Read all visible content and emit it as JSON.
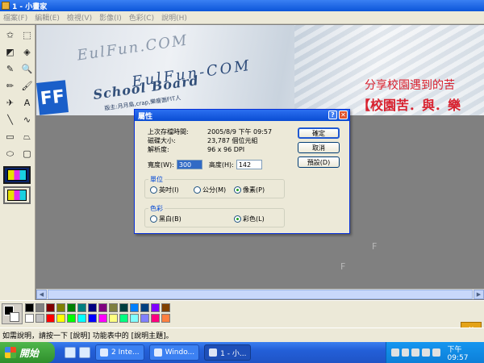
{
  "window": {
    "title": "1 - 小畫家"
  },
  "menu": [
    "檔案(F)",
    "編輯(E)",
    "檢視(V)",
    "影像(I)",
    "色彩(C)",
    "說明(H)"
  ],
  "tools": [
    {
      "name": "free-select-icon",
      "glyph": "✩"
    },
    {
      "name": "rect-select-icon",
      "glyph": "⬚"
    },
    {
      "name": "eraser-icon",
      "glyph": "◩"
    },
    {
      "name": "fill-bucket-icon",
      "glyph": "◈"
    },
    {
      "name": "color-picker-icon",
      "glyph": "✎"
    },
    {
      "name": "magnifier-icon",
      "glyph": "🔍"
    },
    {
      "name": "pencil-icon",
      "glyph": "✏"
    },
    {
      "name": "brush-icon",
      "glyph": "🖌"
    },
    {
      "name": "airbrush-icon",
      "glyph": "✈"
    },
    {
      "name": "text-icon",
      "glyph": "A"
    },
    {
      "name": "line-icon",
      "glyph": "╲"
    },
    {
      "name": "curve-icon",
      "glyph": "∿"
    },
    {
      "name": "rectangle-icon",
      "glyph": "▭"
    },
    {
      "name": "polygon-icon",
      "glyph": "⏢"
    },
    {
      "name": "ellipse-icon",
      "glyph": "⬭"
    },
    {
      "name": "rounded-rect-icon",
      "glyph": "▢"
    }
  ],
  "canvas": {
    "board_line1": "EulFun.COM",
    "board_line2": "School Board",
    "board_line3": "EulFun-COM",
    "board_subtitle": "版主:月月島,crap,樂瘦面FIT人",
    "logo_text": "FF",
    "slogan1": "分享校園遇到的苦",
    "slogan2": "【校園苦．與．樂",
    "ghost_letter": "F"
  },
  "dialog": {
    "title": "屬性",
    "rows": [
      {
        "label": "上次存檔時間:",
        "value": "2005/8/9 下午 09:57"
      },
      {
        "label": "磁碟大小:",
        "value": "23,787 個位元組"
      },
      {
        "label": "解析度:",
        "value": "96 x 96 DPI"
      }
    ],
    "buttons": {
      "ok": "確定",
      "cancel": "取消",
      "default": "預設(D)"
    },
    "width_label": "寬度(W):",
    "width_value": "300",
    "height_label": "高度(H):",
    "height_value": "142",
    "units": {
      "legend": "單位",
      "inch": "英吋(I)",
      "cm": "公分(M)",
      "pixel": "像素(P)",
      "selected": "pixel"
    },
    "colors": {
      "legend": "色彩",
      "bw": "黑白(B)",
      "color": "彩色(L)",
      "selected": "color"
    }
  },
  "palette": [
    "#000000",
    "#808080",
    "#800000",
    "#808000",
    "#008000",
    "#008080",
    "#000080",
    "#800080",
    "#808040",
    "#004040",
    "#0080ff",
    "#004080",
    "#8000ff",
    "#804000",
    "#ffffff",
    "#c0c0c0",
    "#ff0000",
    "#ffff00",
    "#00ff00",
    "#00ffff",
    "#0000ff",
    "#ff00ff",
    "#ffff80",
    "#00ff80",
    "#80ffff",
    "#8080ff",
    "#ff0080",
    "#ff8040"
  ],
  "status": "如需說明，請按一下 [說明] 功能表中的 [說明主題]。",
  "taskbar": {
    "start": "開始",
    "items": [
      {
        "label": "2 Inte...",
        "active": false
      },
      {
        "label": "Windo...",
        "active": false
      },
      {
        "label": "1 - 小...",
        "active": true
      }
    ],
    "clock": "下午 09:57"
  }
}
